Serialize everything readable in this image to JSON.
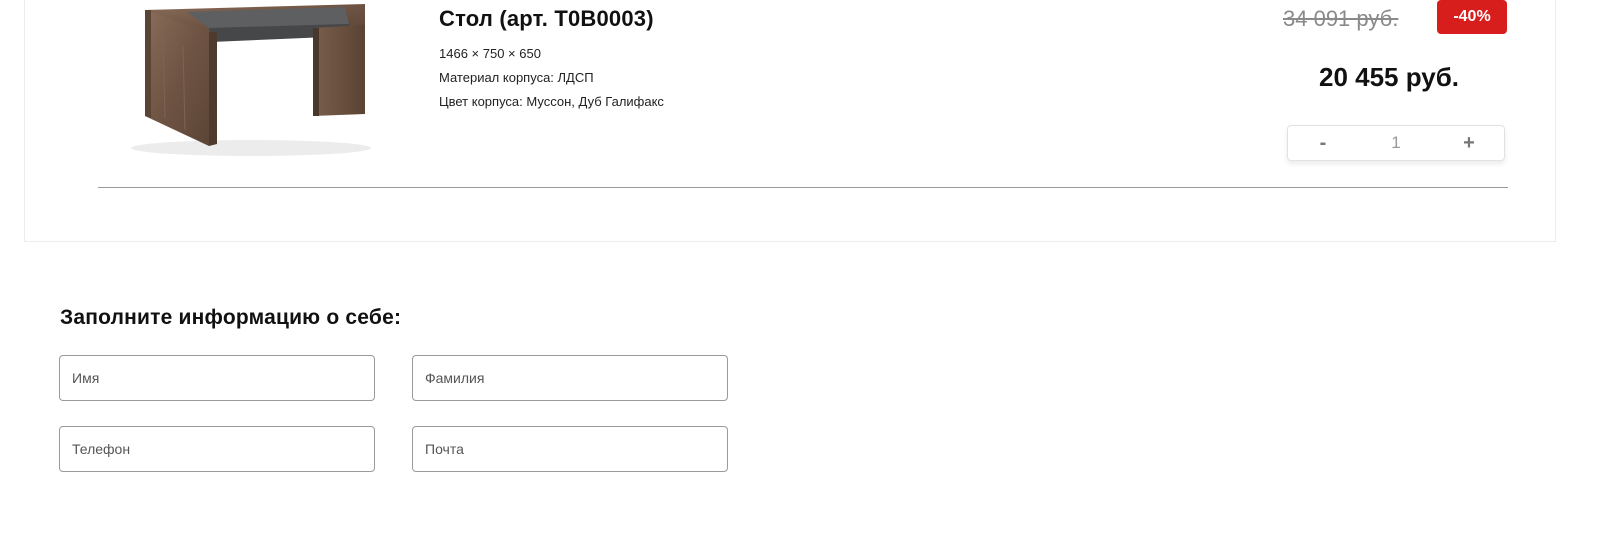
{
  "product": {
    "image_name": "desk-product-image",
    "title": "Стол (арт. T0B0003)",
    "dimensions": "1466 × 750 × 650",
    "material": "Материал корпуса: ЛДСП",
    "color": "Цвет корпуса: Муссон, Дуб Галифакс",
    "old_price": "34 091 руб.",
    "discount": "-40%",
    "new_price": "20 455 руб.",
    "quantity": {
      "minus_label": "-",
      "value": "1",
      "plus_label": "+"
    }
  },
  "form": {
    "heading": "Заполните информацию о себе:",
    "fields": {
      "first_name_placeholder": "Имя",
      "last_name_placeholder": "Фамилия",
      "phone_placeholder": "Телефон",
      "email_placeholder": "Почта"
    }
  },
  "colors": {
    "discount_badge": "#d81d1d",
    "old_price": "#8a8a8a",
    "border": "#9a9a9a"
  }
}
